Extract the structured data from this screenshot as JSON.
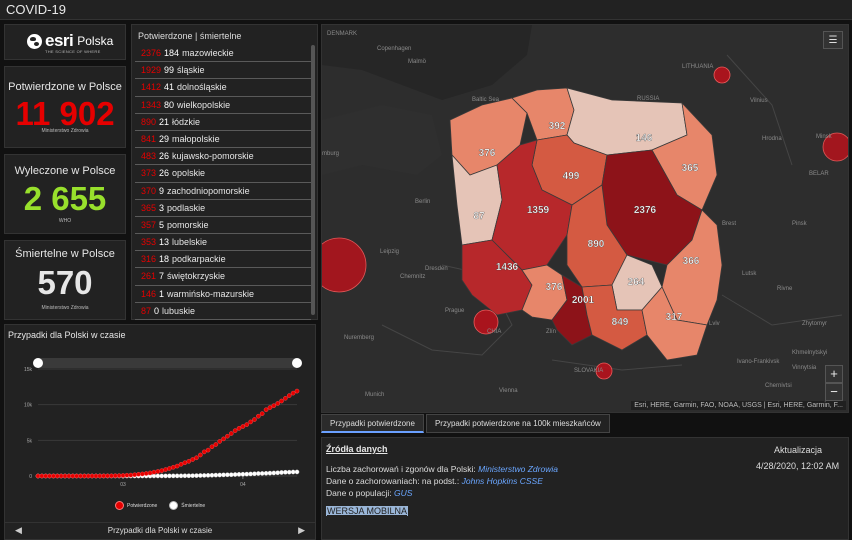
{
  "app": {
    "title": "COVID-19"
  },
  "logo": {
    "word": "esri",
    "country": "Polska",
    "tagline": "THE SCIENCE OF WHERE"
  },
  "stats": {
    "confirmed": {
      "label": "Potwierdzone w Polsce",
      "value": "11 902",
      "source": "Ministerstwo Zdrowia",
      "color": "#e60000"
    },
    "recovered": {
      "label": "Wyleczone w Polsce",
      "value": "2 655",
      "source": "WHO",
      "color": "#98e02c"
    },
    "deaths": {
      "label": "Śmiertelne w Polsce",
      "value": "570",
      "source": "Ministerstwo Zdrowia",
      "color": "#e6e6e6"
    }
  },
  "regions": {
    "header": "Potwierdzone | śmiertelne",
    "items": [
      {
        "confirmed": "2376",
        "deaths": "184",
        "name": "mazowieckie"
      },
      {
        "confirmed": "1929",
        "deaths": "99",
        "name": "śląskie"
      },
      {
        "confirmed": "1412",
        "deaths": "41",
        "name": "dolnośląskie"
      },
      {
        "confirmed": "1343",
        "deaths": "80",
        "name": "wielkopolskie"
      },
      {
        "confirmed": "890",
        "deaths": "21",
        "name": "łódzkie"
      },
      {
        "confirmed": "841",
        "deaths": "29",
        "name": "małopolskie"
      },
      {
        "confirmed": "483",
        "deaths": "26",
        "name": "kujawsko-pomorskie"
      },
      {
        "confirmed": "373",
        "deaths": "26",
        "name": "opolskie"
      },
      {
        "confirmed": "370",
        "deaths": "9",
        "name": "zachodniopomorskie"
      },
      {
        "confirmed": "365",
        "deaths": "3",
        "name": "podlaskie"
      },
      {
        "confirmed": "357",
        "deaths": "5",
        "name": "pomorskie"
      },
      {
        "confirmed": "353",
        "deaths": "13",
        "name": "lubelskie"
      },
      {
        "confirmed": "316",
        "deaths": "18",
        "name": "podkarpackie"
      },
      {
        "confirmed": "261",
        "deaths": "7",
        "name": "świętokrzyskie"
      },
      {
        "confirmed": "146",
        "deaths": "1",
        "name": "warmińsko-mazurskie"
      },
      {
        "confirmed": "87",
        "deaths": "0",
        "name": "lubuskie"
      }
    ]
  },
  "map": {
    "list_icon": "list-icon",
    "zoom_in": "+",
    "zoom_out": "−",
    "attribution": "Esri, HERE, Garmin, FAO, NOAA, USGS | Esri, HERE, Garmin, F...",
    "place_labels": {
      "copenhagen": "Copenhagen",
      "malmo": "Malmö",
      "baltic_sea": "Baltic\nSea",
      "russia": "RUSSIA",
      "lithuania": "LITHUANIA",
      "vilnius": "Vilnius",
      "minsk": "Minsk",
      "belarus": "BELAR",
      "hamburg": "mburg",
      "berlin": "Berlin",
      "dresden": "Dresden",
      "leipzig": "Leipzig",
      "chemnitz": "Chemnitz",
      "prague": "Prague",
      "czechia": "CHIA",
      "nuremberg": "Nuremberg",
      "munich": "Munich",
      "vienna": "Vienna",
      "slovakia": "SLOVAKIA",
      "denmark": "DENMARK",
      "lviv": "Lviv",
      "ivano": "Ivano-Frankivsk",
      "chernivtsi": "Chernivtsi",
      "kishinev": "Khmelnytskyi",
      "vinnytsia": "Vinnytsia",
      "zhytomyr": "Zhytomyr",
      "rivne": "Rivne",
      "lutsk": "Lutsk",
      "brest": "Brest",
      "hrodna": "Hrodna",
      "pinsk": "Pinsk",
      "zlin": "Zlín"
    },
    "region_labels": [
      "392",
      "146",
      "376",
      "365",
      "499",
      "87",
      "1359",
      "2376",
      "890",
      "1436",
      "366",
      "376",
      "264",
      "2001",
      "849",
      "317"
    ],
    "colors": {
      "dark": "#8d1319",
      "darkmid": "#b7282b",
      "mid": "#d45a42",
      "light": "#e7866a",
      "pale": "#e5c4b7",
      "bubble": "#b7121c"
    }
  },
  "tabs": [
    {
      "label": "Przypadki potwierdzone",
      "active": true
    },
    {
      "label": "Przypadki potwierdzone na 100k mieszkańców",
      "active": false
    }
  ],
  "sources": {
    "header": "Źródła danych",
    "update_header": "Aktualizacja",
    "update_date": "4/28/2020, 12:02 AM",
    "line1_text": "Liczba zachorowań i zgonów dla Polski: ",
    "line1_link": "Ministerstwo Zdrowia",
    "line2_text": "Dane o zachorowaniach: na podst.: ",
    "line2_link": "Johns Hopkins CSSE",
    "line3_text": "Dane o populacji: ",
    "line3_link": "GUS",
    "mobile": "WERSJA MOBILNA"
  },
  "chart": {
    "title": "Przypadki dla Polski w czasie",
    "footer_title": "Przypadki dla Polski w czasie",
    "prev_icon": "triangle-left-icon",
    "next_icon": "triangle-right-icon",
    "prev_glyph": "◀",
    "next_glyph": "▶"
  },
  "chart_data": {
    "type": "scatter",
    "title": "Przypadki dla Polski w czasie",
    "xlabel": "",
    "ylabel": "",
    "x_ticks": [
      "03",
      "04"
    ],
    "y_ticks": [
      "0",
      "5k",
      "10k",
      "15k"
    ],
    "ylim": [
      0,
      15000
    ],
    "grid": true,
    "legend_position": "bottom",
    "series": [
      {
        "name": "Potwierdzone",
        "color": "#e60000",
        "values": [
          0,
          0,
          0,
          0,
          0,
          0,
          0,
          0,
          0,
          0,
          0,
          0,
          0,
          0,
          1,
          1,
          5,
          11,
          17,
          22,
          31,
          49,
          68,
          104,
          125,
          177,
          238,
          287,
          355,
          425,
          536,
          634,
          749,
          901,
          1051,
          1221,
          1389,
          1638,
          1862,
          2055,
          2311,
          2554,
          2946,
          3383,
          3627,
          4102,
          4413,
          4848,
          5205,
          5575,
          5955,
          6356,
          6674,
          6934,
          7202,
          7582,
          7918,
          8379,
          8742,
          9287,
          9593,
          9856,
          10169,
          10511,
          10892,
          11273,
          11617,
          11902
        ]
      },
      {
        "name": "Śmiertelne",
        "color": "#ffffff",
        "values": [
          0,
          0,
          0,
          0,
          0,
          0,
          0,
          0,
          0,
          0,
          0,
          0,
          0,
          0,
          0,
          0,
          0,
          0,
          0,
          0,
          0,
          1,
          1,
          3,
          3,
          3,
          5,
          5,
          5,
          5,
          7,
          7,
          8,
          10,
          14,
          16,
          18,
          23,
          31,
          33,
          43,
          57,
          71,
          79,
          94,
          107,
          129,
          140,
          159,
          174,
          181,
          208,
          232,
          245,
          263,
          286,
          314,
          347,
          360,
          380,
          401,
          426,
          454,
          494,
          524,
          535,
          562,
          570
        ]
      }
    ]
  }
}
